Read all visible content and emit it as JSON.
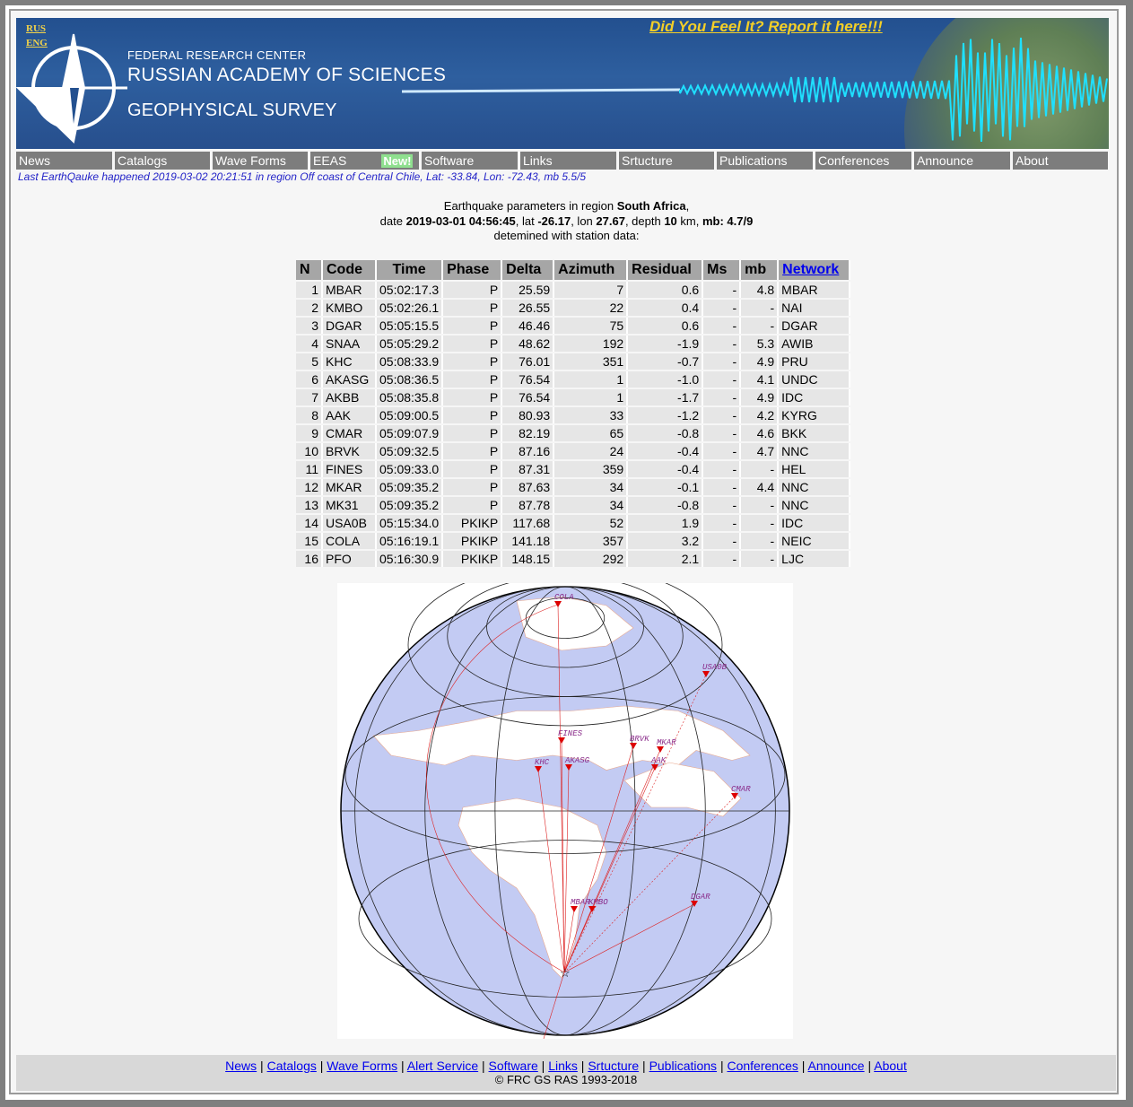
{
  "banner": {
    "lang_rus": "RUS",
    "lang_eng": "ENG",
    "line1": "FEDERAL RESEARCH CENTER",
    "line2": "RUSSIAN ACADEMY OF SCIENCES",
    "line3": "GEOPHYSICAL SURVEY",
    "feel_link": "Did You Feel It? Report it here!!!"
  },
  "menu": {
    "items": [
      "News",
      "Catalogs",
      "Wave Forms",
      "EEAS",
      "Software",
      "Links",
      "Srtucture",
      "Publications",
      "Conferences",
      "Announce",
      "About"
    ],
    "new_badge": "New!"
  },
  "last_quake": "Last EarthQauke happened 2019-03-02 20:21:51 in region Off coast of Central Chile, Lat: -33.84, Lon: -72.43, mb 5.5/5",
  "params": {
    "l1_prefix": "Earthquake parameters in region ",
    "region": "South Africa",
    "l1_suffix": ",",
    "l2_date_label": "date ",
    "date": "2019-03-01 04:56:45",
    "lat_label": ", lat ",
    "lat": "-26.17",
    "lon_label": ", lon ",
    "lon": "27.67",
    "depth_label": ", depth ",
    "depth": "10",
    "km_label": " km, ",
    "mb_label": "mb:",
    "mb": " 4.7/9",
    "l3": "detemined with station data:"
  },
  "table": {
    "headers": [
      "N",
      "Code",
      "Time",
      "Phase",
      "Delta",
      "Azimuth",
      "Residual",
      "Ms",
      "mb",
      "Network"
    ],
    "rows": [
      [
        "1",
        "MBAR",
        "05:02:17.3",
        "P",
        "25.59",
        "7",
        "0.6",
        "-",
        "4.8",
        "MBAR"
      ],
      [
        "2",
        "KMBO",
        "05:02:26.1",
        "P",
        "26.55",
        "22",
        "0.4",
        "-",
        "-",
        "NAI"
      ],
      [
        "3",
        "DGAR",
        "05:05:15.5",
        "P",
        "46.46",
        "75",
        "0.6",
        "-",
        "-",
        "DGAR"
      ],
      [
        "4",
        "SNAA",
        "05:05:29.2",
        "P",
        "48.62",
        "192",
        "-1.9",
        "-",
        "5.3",
        "AWIB"
      ],
      [
        "5",
        "KHC",
        "05:08:33.9",
        "P",
        "76.01",
        "351",
        "-0.7",
        "-",
        "4.9",
        "PRU"
      ],
      [
        "6",
        "AKASG",
        "05:08:36.5",
        "P",
        "76.54",
        "1",
        "-1.0",
        "-",
        "4.1",
        "UNDC"
      ],
      [
        "7",
        "AKBB",
        "05:08:35.8",
        "P",
        "76.54",
        "1",
        "-1.7",
        "-",
        "4.9",
        "IDC"
      ],
      [
        "8",
        "AAK",
        "05:09:00.5",
        "P",
        "80.93",
        "33",
        "-1.2",
        "-",
        "4.2",
        "KYRG"
      ],
      [
        "9",
        "CMAR",
        "05:09:07.9",
        "P",
        "82.19",
        "65",
        "-0.8",
        "-",
        "4.6",
        "BKK"
      ],
      [
        "10",
        "BRVK",
        "05:09:32.5",
        "P",
        "87.16",
        "24",
        "-0.4",
        "-",
        "4.7",
        "NNC"
      ],
      [
        "11",
        "FINES",
        "05:09:33.0",
        "P",
        "87.31",
        "359",
        "-0.4",
        "-",
        "-",
        "HEL"
      ],
      [
        "12",
        "MKAR",
        "05:09:35.2",
        "P",
        "87.63",
        "34",
        "-0.1",
        "-",
        "4.4",
        "NNC"
      ],
      [
        "13",
        "MK31",
        "05:09:35.2",
        "P",
        "87.78",
        "34",
        "-0.8",
        "-",
        "-",
        "NNC"
      ],
      [
        "14",
        "USA0B",
        "05:15:34.0",
        "PKIKP",
        "117.68",
        "52",
        "1.9",
        "-",
        "-",
        "IDC"
      ],
      [
        "15",
        "COLA",
        "05:16:19.1",
        "PKIKP",
        "141.18",
        "357",
        "3.2",
        "-",
        "-",
        "NEIC"
      ],
      [
        "16",
        "PFO",
        "05:16:30.9",
        "PKIKP",
        "148.15",
        "292",
        "2.1",
        "-",
        "-",
        "LJC"
      ]
    ]
  },
  "map": {
    "stations": [
      "COLA",
      "USA0B",
      "FINES",
      "BRVK",
      "MKAR",
      "KHC",
      "AKASG",
      "AAK",
      "CMAR",
      "MBAR",
      "KMBO",
      "DGAR"
    ],
    "colors": {
      "ocean": "#c3cbf3",
      "land": "#ffffff",
      "ray": "#d22",
      "station": "#d00"
    }
  },
  "footer": {
    "links": [
      "News",
      "Catalogs",
      "Wave Forms",
      "Alert Service",
      "Software",
      "Links",
      "Srtucture",
      "Publications",
      "Conferences",
      "Announce",
      "About"
    ],
    "copyright": "© FRC GS RAS 1993-2018"
  }
}
